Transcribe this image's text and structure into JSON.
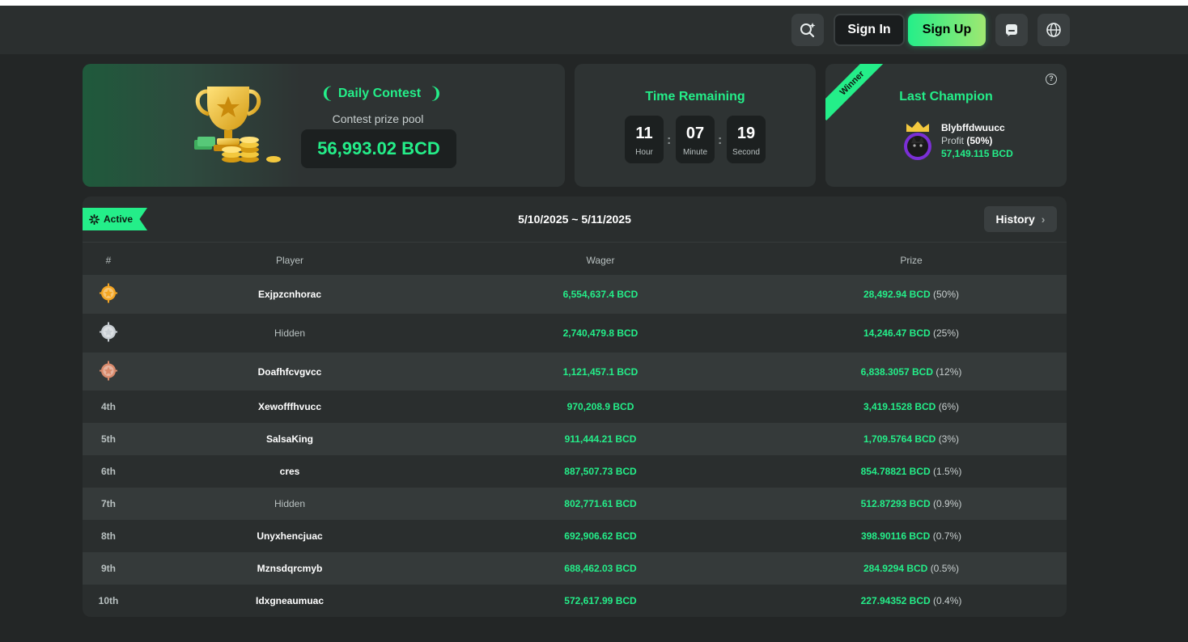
{
  "header": {
    "sign_in": "Sign In",
    "sign_up": "Sign Up",
    "icons": [
      "search-icon",
      "chat-icon",
      "globe-icon"
    ]
  },
  "contest": {
    "title": "Daily Contest",
    "pool_label": "Contest prize pool",
    "pool_amount": "56,993.02 BCD"
  },
  "timer": {
    "title": "Time Remaining",
    "hour": "11",
    "hour_label": "Hour",
    "minute": "07",
    "minute_label": "Minute",
    "second": "19",
    "second_label": "Second"
  },
  "champion": {
    "ribbon": "Winner",
    "title": "Last Champion",
    "name": "Blybffdwuucc",
    "profit_label": "Profit",
    "profit_pct": "(50%)",
    "amount": "57,149.115 BCD"
  },
  "board": {
    "status": "Active",
    "date_range": "5/10/2025 ~ 5/11/2025",
    "history": "History",
    "headers": {
      "rank": "#",
      "player": "Player",
      "wager": "Wager",
      "prize": "Prize"
    },
    "rows": [
      {
        "rank": "",
        "medal": "gold",
        "player": "Exjpzcnhorac",
        "hidden": false,
        "wager": "6,554,637.4 BCD",
        "prize": "28,492.94 BCD",
        "pct": "(50%)"
      },
      {
        "rank": "",
        "medal": "silver",
        "player": "Hidden",
        "hidden": true,
        "wager": "2,740,479.8 BCD",
        "prize": "14,246.47 BCD",
        "pct": "(25%)"
      },
      {
        "rank": "",
        "medal": "bronze",
        "player": "Doafhfcvgvcc",
        "hidden": false,
        "wager": "1,121,457.1 BCD",
        "prize": "6,838.3057 BCD",
        "pct": "(12%)"
      },
      {
        "rank": "4th",
        "medal": "",
        "player": "Xewofffhvucc",
        "hidden": false,
        "wager": "970,208.9 BCD",
        "prize": "3,419.1528 BCD",
        "pct": "(6%)"
      },
      {
        "rank": "5th",
        "medal": "",
        "player": "SalsaKing",
        "hidden": false,
        "wager": "911,444.21 BCD",
        "prize": "1,709.5764 BCD",
        "pct": "(3%)"
      },
      {
        "rank": "6th",
        "medal": "",
        "player": "cres",
        "hidden": false,
        "wager": "887,507.73 BCD",
        "prize": "854.78821 BCD",
        "pct": "(1.5%)"
      },
      {
        "rank": "7th",
        "medal": "",
        "player": "Hidden",
        "hidden": true,
        "wager": "802,771.61 BCD",
        "prize": "512.87293 BCD",
        "pct": "(0.9%)"
      },
      {
        "rank": "8th",
        "medal": "",
        "player": "Unyxhencjuac",
        "hidden": false,
        "wager": "692,906.62 BCD",
        "prize": "398.90116 BCD",
        "pct": "(0.7%)"
      },
      {
        "rank": "9th",
        "medal": "",
        "player": "Mznsdqrcmyb",
        "hidden": false,
        "wager": "688,462.03 BCD",
        "prize": "284.9294 BCD",
        "pct": "(0.5%)"
      },
      {
        "rank": "10th",
        "medal": "",
        "player": "Idxgneaumuac",
        "hidden": false,
        "wager": "572,617.99 BCD",
        "prize": "227.94352 BCD",
        "pct": "(0.4%)"
      }
    ]
  },
  "colors": {
    "accent": "#24ee89",
    "gold": "#f5a623",
    "silver": "#c9cfd4",
    "bronze": "#d98a6c"
  }
}
